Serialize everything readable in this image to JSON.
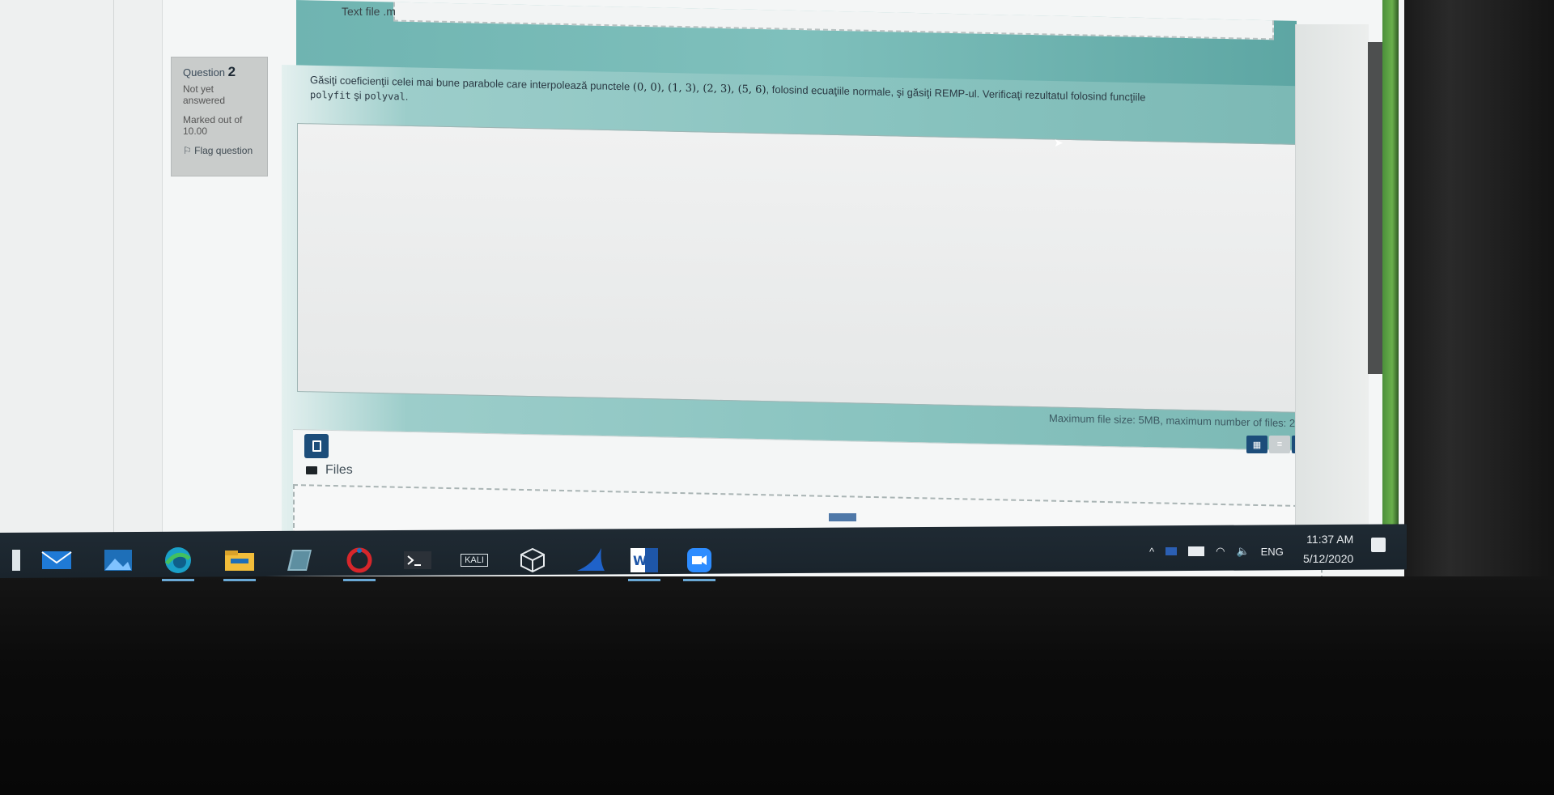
{
  "header": {
    "text_file_label": "Text file .m"
  },
  "question": {
    "label": "Question",
    "number": "2",
    "state": "Not yet answered",
    "marked_out_of": "Marked out of 10.00",
    "flag_label": "Flag question",
    "text_prefix": "Găsiţi coeficienţii celei mai bune parabole care interpolează punctele",
    "points": "(0, 0), (1, 3), (2, 3), (5, 6)",
    "text_suffix": ", folosind ecuaţiile normale, şi găsiţi REMP-ul. Verificaţi rezultatul folosind funcţiile",
    "fn_polyfit": "polyfit",
    "conj": "şi",
    "fn_polyval": "polyval",
    "period": "."
  },
  "filepicker": {
    "limits_text": "Maximum file size: 5MB, maximum number of files: 2",
    "files_label": "Files",
    "view_modes": [
      "grid",
      "list",
      "tree"
    ]
  },
  "taskbar": {
    "apps": [
      "mail-app",
      "photos-app",
      "edge-browser",
      "file-explorer",
      "notepad-app",
      "app-red-ring",
      "terminal-app",
      "kali-app",
      "virtualbox-app",
      "shark-app",
      "word-app",
      "zoom-app"
    ],
    "kali_label": "KALI",
    "tray_lang": "ENG",
    "time": "11:37 AM",
    "date": "5/12/2020"
  }
}
